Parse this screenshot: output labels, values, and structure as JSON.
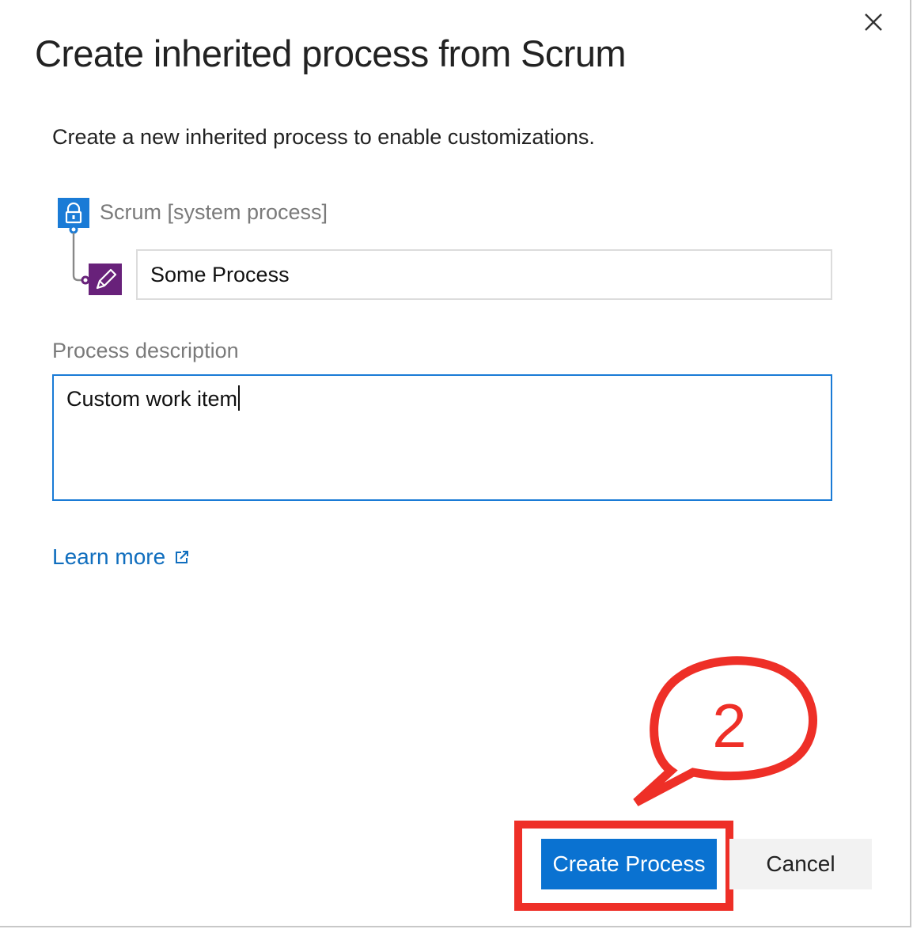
{
  "dialog": {
    "title": "Create inherited process from Scrum",
    "subtitle": "Create a new inherited process to enable customizations.",
    "close_icon": "close-icon"
  },
  "process": {
    "parent_label": "Scrum [system process]",
    "parent_icon": "lock-icon",
    "child_icon": "pencil-icon",
    "name_value": "Some Process"
  },
  "description": {
    "label": "Process description",
    "value": "Custom work item"
  },
  "learn_more": {
    "label": "Learn more",
    "icon": "external-link-icon"
  },
  "buttons": {
    "create_label": "Create Process",
    "cancel_label": "Cancel"
  },
  "annotation": {
    "step_number": "2",
    "color": "#ee2f27"
  },
  "colors": {
    "primary": "#0a72d1",
    "link": "#106ebe",
    "parent_icon_bg": "#1a7bd6",
    "child_icon_bg": "#68217a"
  }
}
